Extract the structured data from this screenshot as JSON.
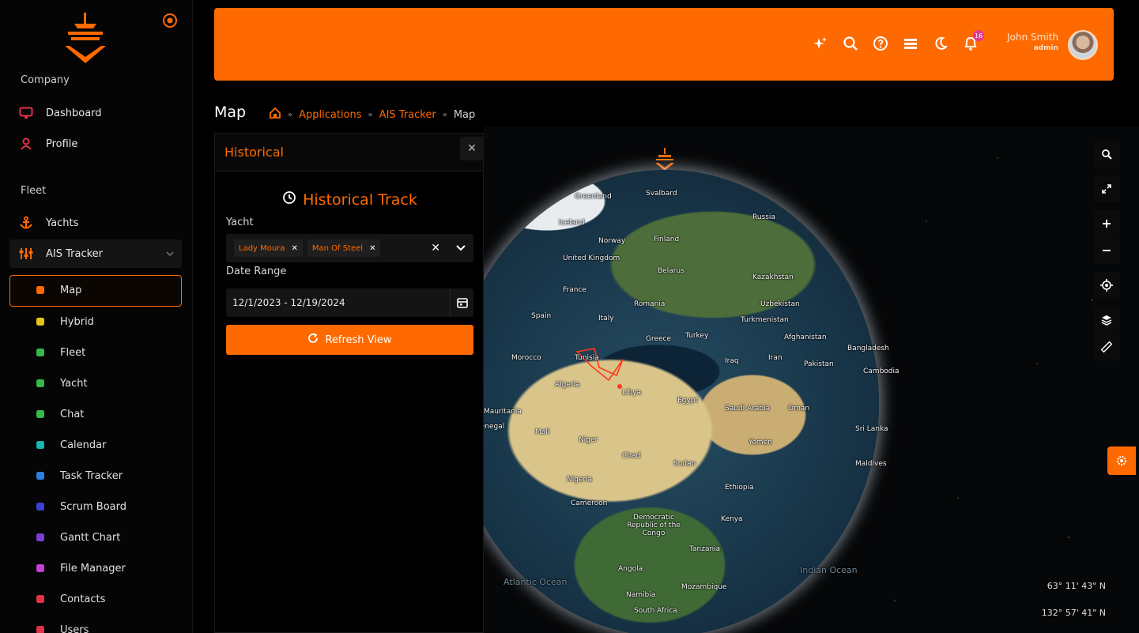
{
  "colors": {
    "accent": "#ff6a00",
    "background": "#000000",
    "sidebar": "#050505"
  },
  "sidebar": {
    "section_company": "Company",
    "company_items": [
      {
        "label": "Dashboard",
        "icon": "monitor-icon"
      },
      {
        "label": "Profile",
        "icon": "user-icon"
      }
    ],
    "section_fleet": "Fleet",
    "fleet_items": [
      {
        "label": "Yachts",
        "icon": "anchor-icon"
      },
      {
        "label": "AIS Tracker",
        "icon": "sliders-icon"
      }
    ],
    "sub_items": [
      {
        "label": "Map",
        "icon": "compass-icon",
        "color": "#ff6a00"
      },
      {
        "label": "Hybrid",
        "icon": "hybrid-icon",
        "color": "#e6c21a"
      },
      {
        "label": "Fleet",
        "icon": "file-icon",
        "color": "#35b84a"
      },
      {
        "label": "Yacht",
        "icon": "dash-icon",
        "color": "#35b84a"
      },
      {
        "label": "Chat",
        "icon": "chat-icon",
        "color": "#35b84a"
      },
      {
        "label": "Calendar",
        "icon": "calendar-icon",
        "color": "#18b6b0"
      },
      {
        "label": "Task Tracker",
        "icon": "clipboard-icon",
        "color": "#2f7de0"
      },
      {
        "label": "Scrum Board",
        "icon": "board-icon",
        "color": "#3d3fd6"
      },
      {
        "label": "Gantt Chart",
        "icon": "gantt-icon",
        "color": "#7a3fd6"
      },
      {
        "label": "File Manager",
        "icon": "folder-icon",
        "color": "#c63fd6"
      },
      {
        "label": "Contacts",
        "icon": "phone-icon",
        "color": "#e0334a"
      },
      {
        "label": "Users",
        "icon": "users-icon",
        "color": "#e0334a"
      }
    ]
  },
  "header": {
    "notification_count": "16",
    "user_name": "John Smith",
    "user_role": "admin"
  },
  "breadcrumb": {
    "title": "Map",
    "items": [
      "Applications",
      "AIS Tracker",
      "Map"
    ]
  },
  "panel": {
    "header": "Historical",
    "title": "Historical Track",
    "yacht_label": "Yacht",
    "selected_yachts": [
      "Lady Moura",
      "Man Of Steel"
    ],
    "date_label": "Date Range",
    "date_value": "12/1/2023 - 12/19/2024",
    "refresh_label": "Refresh View"
  },
  "map": {
    "places": [
      "Svalbard",
      "Greenland",
      "Iceland",
      "Russia",
      "Norway",
      "Finland",
      "United Kingdom",
      "Belarus",
      "France",
      "Romania",
      "Kazakhstan",
      "Uzbekistan",
      "Turkmenistan",
      "Spain",
      "Italy",
      "Greece",
      "Turkey",
      "Afghanistan",
      "Morocco",
      "Tunisia",
      "Iraq",
      "Iran",
      "Pakistan",
      "Bangladesh",
      "Cambodia",
      "Algeria",
      "Libya",
      "Egypt",
      "Saudi Arabia",
      "Oman",
      "Mauritania",
      "Senegal",
      "Mali",
      "Niger",
      "Chad",
      "Sudan",
      "Yemen",
      "Sri Lanka",
      "Maldives",
      "Nigeria",
      "Ethiopia",
      "Cameroon",
      "Democratic Republic of the Congo",
      "Kenya",
      "Tanzania",
      "Angola",
      "Mozambique",
      "Namibia",
      "South Africa",
      "Atlantic Ocean",
      "Indian Ocean"
    ],
    "latitude": "63° 11' 43\" N",
    "longitude": "132° 57' 41\" N"
  }
}
